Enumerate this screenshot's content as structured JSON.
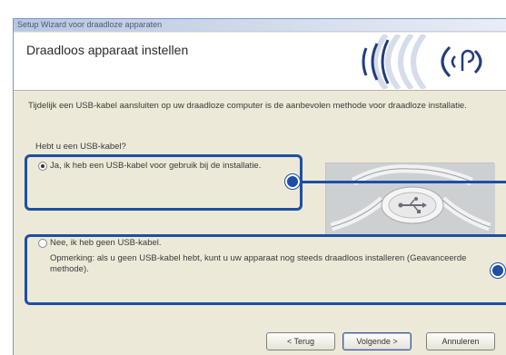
{
  "window": {
    "title": "Setup Wizard voor draadloze apparaten"
  },
  "header": {
    "title": "Draadloos apparaat instellen",
    "logo_icon": "wifi-signal-icon"
  },
  "body": {
    "instruction": "Tijdelijk een USB-kabel aansluiten op uw draadloze computer is de aanbevolen methode voor draadloze installatie.",
    "question": "Hebt u een USB-kabel?",
    "option_yes": {
      "label": "Ja, ik heb een USB-kabel voor gebruik bij de installatie.",
      "selected": true
    },
    "option_no": {
      "label": "Nee, ik heb geen USB-kabel.",
      "note": "Opmerking: als u geen USB-kabel hebt, kunt u uw apparaat nog steeds draadloos installeren (Geavanceerde methode).",
      "selected": false
    },
    "image_icon": "usb-cable-image"
  },
  "buttons": {
    "back": "< Terug",
    "next": "Volgende >",
    "cancel": "Annuleren"
  },
  "colors": {
    "highlight": "#1e4fa3",
    "dialog_bg": "#ece9d8"
  }
}
